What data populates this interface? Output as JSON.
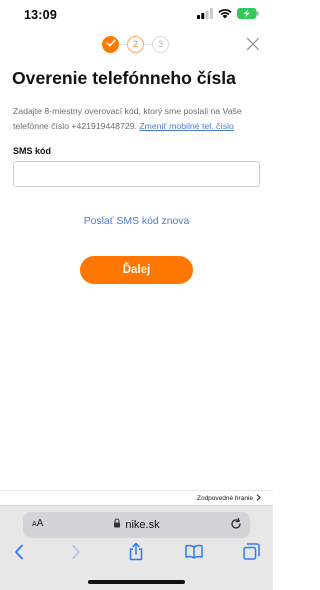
{
  "status_bar": {
    "time": "13:09",
    "icons": [
      "signal-icon",
      "wifi-icon",
      "battery-charging-icon"
    ]
  },
  "stepper": {
    "steps": [
      {
        "label": "",
        "state": "done"
      },
      {
        "label": "2",
        "state": "active"
      },
      {
        "label": "3",
        "state": "idle"
      }
    ],
    "close_icon": "close-icon"
  },
  "page": {
    "title": "Overenie telefónneho čísla",
    "instructions": "Zadajte 8-miestny overovací kód, ktorý sme poslali na Vaše telefónne číslo +421919448729.",
    "change_link": "Zmeniť mobilné tel. číslo",
    "field_label": "SMS kód",
    "sms_value": "",
    "resend_label": "Poslať SMS kód znova",
    "next_label": "Ďalej"
  },
  "footer": {
    "responsible_link": "Zodpovedné hranie"
  },
  "browser": {
    "text_size_label_small": "A",
    "text_size_label_large": "A",
    "url": "nike.sk"
  },
  "colors": {
    "accent": "#ff7600",
    "link": "#4a7bd0",
    "ios_blue": "#2f7bf5"
  }
}
